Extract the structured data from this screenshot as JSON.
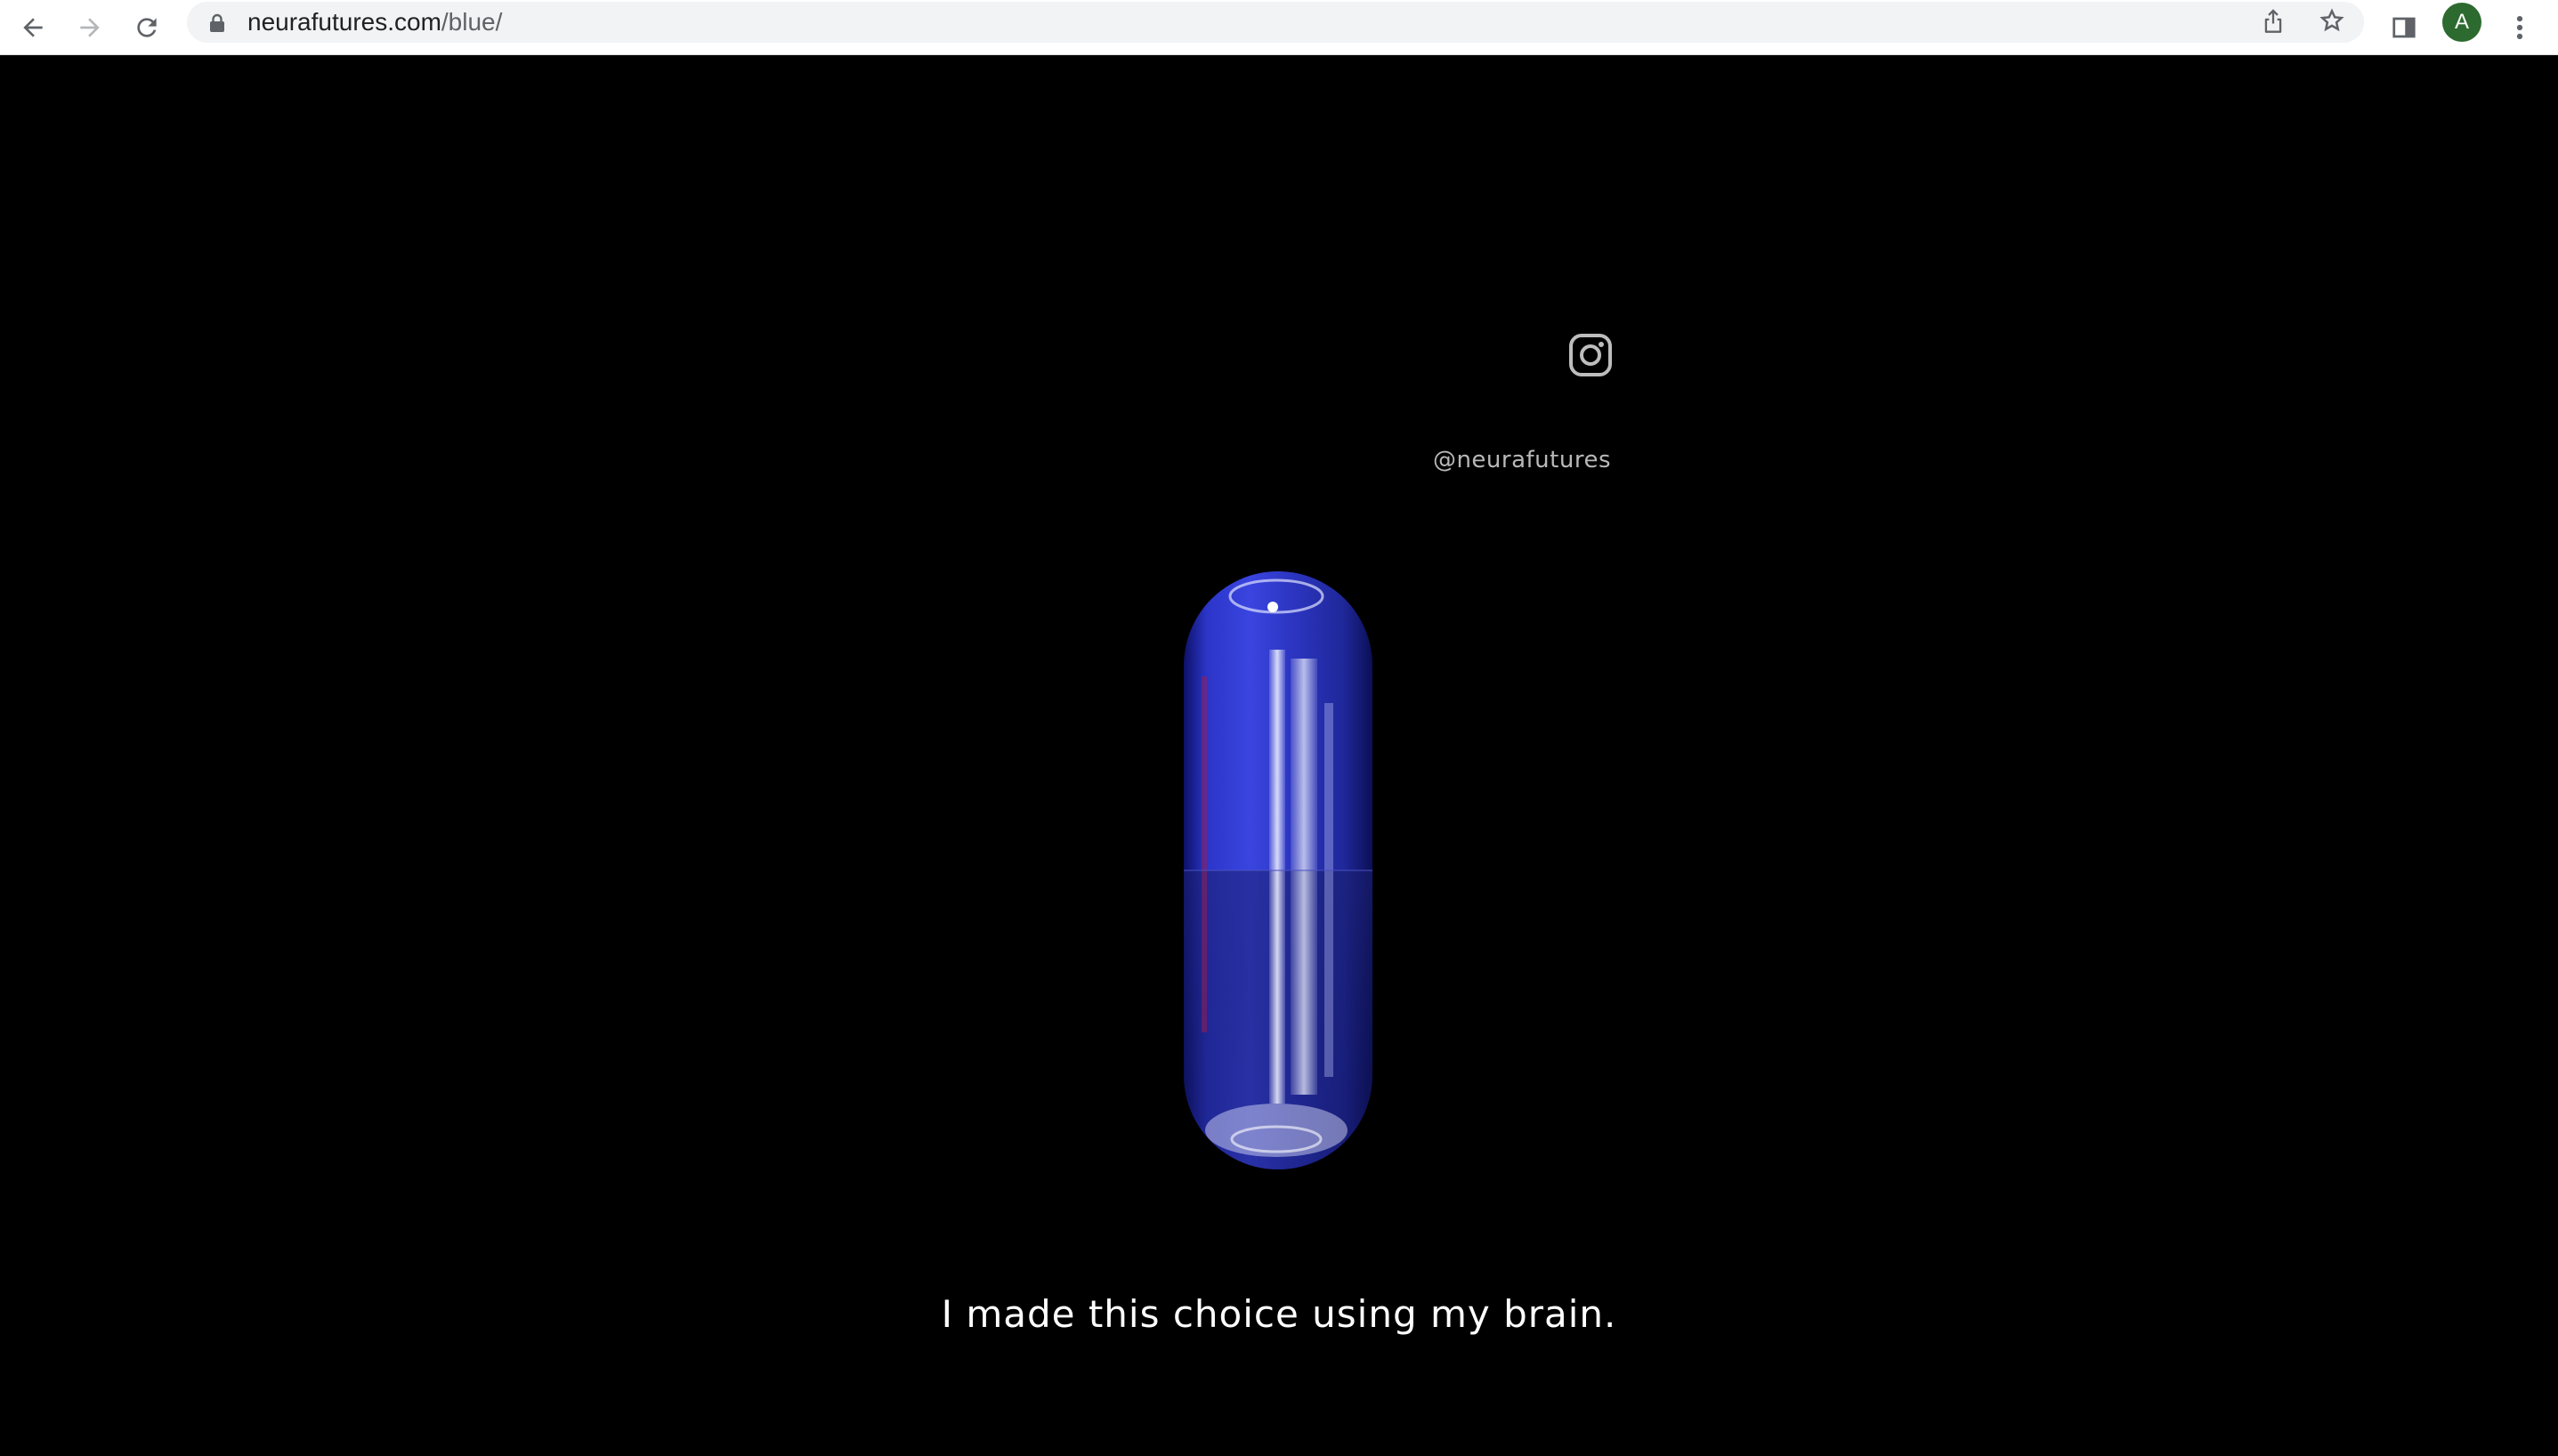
{
  "browser": {
    "url_host": "neurafutures.com",
    "url_path": "/blue/",
    "profile_initial": "A",
    "profile_color": "#2d6a2f",
    "icons": {
      "back": "arrow-left-icon",
      "forward": "arrow-right-icon",
      "reload": "reload-icon",
      "lock": "lock-icon",
      "share": "share-icon",
      "bookmark": "star-icon",
      "side_panel": "side-panel-icon",
      "menu": "kebab-menu-icon"
    }
  },
  "page": {
    "background": "#000000",
    "social": {
      "icon": "instagram-icon",
      "handle": "@neurafutures"
    },
    "pill_color": "#2b35c8",
    "tagline": "I made this choice using my brain."
  }
}
